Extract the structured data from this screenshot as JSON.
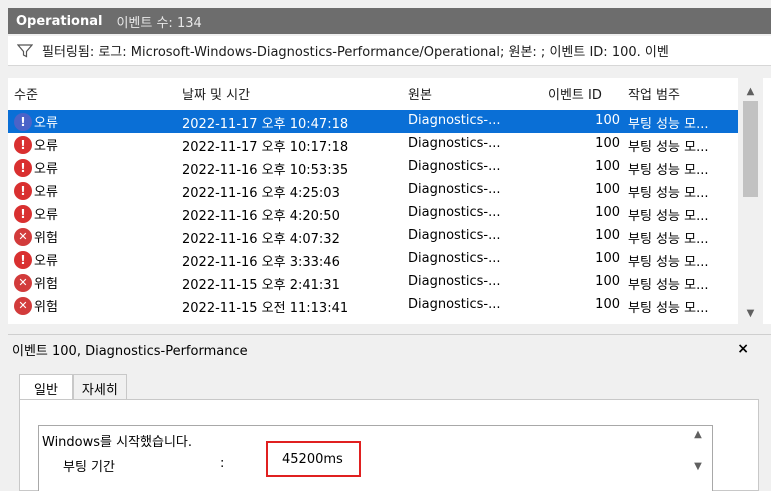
{
  "titlebar": {
    "log_name": "Operational",
    "event_count": "이벤트 수: 134"
  },
  "filter": {
    "text": "필터링됨: 로그: Microsoft-Windows-Diagnostics-Performance/Operational; 원본: ; 이벤트 ID: 100. 이벤"
  },
  "columns": {
    "level": "수준",
    "date": "날짜 및 시간",
    "source": "원본",
    "event_id": "이벤트 ID",
    "task": "작업 범주"
  },
  "rows": [
    {
      "level": "오류",
      "type": "error",
      "date": "2022-11-17 오후 10:47:18",
      "source": "Diagnostics-...",
      "id": "100",
      "task": "부팅 성능 모...",
      "selected": true
    },
    {
      "level": "오류",
      "type": "error",
      "date": "2022-11-17 오후 10:17:18",
      "source": "Diagnostics-...",
      "id": "100",
      "task": "부팅 성능 모..."
    },
    {
      "level": "오류",
      "type": "error",
      "date": "2022-11-16 오후 10:53:35",
      "source": "Diagnostics-...",
      "id": "100",
      "task": "부팅 성능 모..."
    },
    {
      "level": "오류",
      "type": "error",
      "date": "2022-11-16 오후 4:25:03",
      "source": "Diagnostics-...",
      "id": "100",
      "task": "부팅 성능 모..."
    },
    {
      "level": "오류",
      "type": "error",
      "date": "2022-11-16 오후 4:20:50",
      "source": "Diagnostics-...",
      "id": "100",
      "task": "부팅 성능 모..."
    },
    {
      "level": "위험",
      "type": "critical",
      "date": "2022-11-16 오후 4:07:32",
      "source": "Diagnostics-...",
      "id": "100",
      "task": "부팅 성능 모..."
    },
    {
      "level": "오류",
      "type": "error",
      "date": "2022-11-16 오후 3:33:46",
      "source": "Diagnostics-...",
      "id": "100",
      "task": "부팅 성능 모..."
    },
    {
      "level": "위험",
      "type": "critical",
      "date": "2022-11-15 오후 2:41:31",
      "source": "Diagnostics-...",
      "id": "100",
      "task": "부팅 성능 모..."
    },
    {
      "level": "위험",
      "type": "critical",
      "date": "2022-11-15 오전 11:13:41",
      "source": "Diagnostics-...",
      "id": "100",
      "task": "부팅 성능 모..."
    }
  ],
  "detail": {
    "title": "이벤트 100, Diagnostics-Performance",
    "close": "×",
    "tabs": [
      "일반",
      "자세히"
    ],
    "message": "Windows를 시작했습니다.",
    "field_label": "부팅 기간",
    "field_sep": ":",
    "field_value": "45200ms"
  },
  "icons": {
    "error": "exclamation-icon",
    "critical": "x-circle-icon",
    "filter": "funnel-icon"
  },
  "colors": {
    "selection": "#0a6fd6",
    "error": "#d93030",
    "highlight_border": "#e02020"
  }
}
